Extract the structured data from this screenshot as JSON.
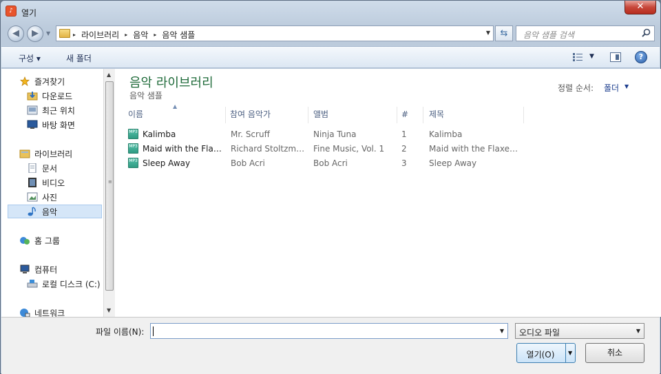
{
  "window": {
    "title": "열기",
    "close_label": "✕"
  },
  "address": {
    "crumbs": [
      "라이브러리",
      "음악",
      "음악 샘플"
    ],
    "separator": "▸"
  },
  "search": {
    "placeholder": "음악 샘플 검색"
  },
  "toolbar": {
    "organize_label": "구성 ▾",
    "new_folder_label": "새 폴더",
    "help_label": "?"
  },
  "nav": {
    "favorites": {
      "label": "즐겨찾기",
      "items": [
        "다운로드",
        "최근 위치",
        "바탕 화면"
      ]
    },
    "libraries": {
      "label": "라이브러리",
      "items": [
        "문서",
        "비디오",
        "사진",
        "음악"
      ]
    },
    "homegroup": {
      "label": "홈 그룹"
    },
    "computer": {
      "label": "컴퓨터",
      "items": [
        "로컬 디스크 (C:)"
      ]
    },
    "network": {
      "label": "네트워크"
    }
  },
  "content": {
    "title": "음악 라이브러리",
    "subtitle": "음악 샘플",
    "sort_label": "정렬 순서:",
    "sort_value": "폴더",
    "columns": [
      "이름",
      "참여 음악가",
      "앨범",
      "#",
      "제목"
    ],
    "rows": [
      {
        "name": "Kalimba",
        "artist": "Mr. Scruff",
        "album": "Ninja Tuna",
        "num": "1",
        "title": "Kalimba"
      },
      {
        "name": "Maid with the Flax...",
        "artist": "Richard Stoltzma...",
        "album": "Fine Music, Vol. 1",
        "num": "2",
        "title": "Maid with the Flaxen ..."
      },
      {
        "name": "Sleep Away",
        "artist": "Bob Acri",
        "album": "Bob Acri",
        "num": "3",
        "title": "Sleep Away"
      }
    ],
    "file_icon_label": "MP3"
  },
  "bottom": {
    "filename_label": "파일 이름(N):",
    "filename_value": "",
    "filter_value": "오디오 파일",
    "open_label": "열기(O)",
    "cancel_label": "취소"
  },
  "colors": {
    "library_title": "#1e6a39",
    "selected_bg": "#d5e6f8"
  }
}
